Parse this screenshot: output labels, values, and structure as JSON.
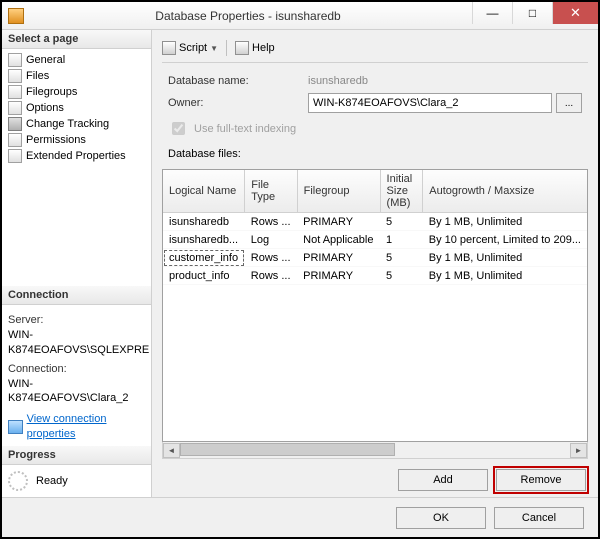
{
  "window": {
    "title": "Database Properties - isunsharedb"
  },
  "win_btns": {
    "min": "—",
    "max": "□",
    "close": "✕"
  },
  "left": {
    "select_page": "Select a page",
    "pages": [
      "General",
      "Files",
      "Filegroups",
      "Options",
      "Change Tracking",
      "Permissions",
      "Extended Properties"
    ],
    "connection_hdr": "Connection",
    "server_lbl": "Server:",
    "server_val": "WIN-K874EOAFOVS\\SQLEXPRE",
    "connection_lbl": "Connection:",
    "connection_val": "WIN-K874EOAFOVS\\Clara_2",
    "view_props": "View connection properties",
    "progress_hdr": "Progress",
    "progress_val": "Ready"
  },
  "toolbar": {
    "script": "Script",
    "help": "Help"
  },
  "form": {
    "db_name_lbl": "Database name:",
    "db_name_val": "isunsharedb",
    "owner_lbl": "Owner:",
    "owner_val": "WIN-K874EOAFOVS\\Clara_2",
    "browse": "...",
    "fulltext": "Use full-text indexing",
    "files_lbl": "Database files:"
  },
  "grid": {
    "cols": [
      "Logical Name",
      "File Type",
      "Filegroup",
      "Initial Size (MB)",
      "Autogrowth / Maxsize"
    ],
    "rows": [
      {
        "name": "isunsharedb",
        "type": "Rows ...",
        "fg": "PRIMARY",
        "size": "5",
        "ag": "By 1 MB, Unlimited"
      },
      {
        "name": "isunsharedb...",
        "type": "Log",
        "fg": "Not Applicable",
        "size": "1",
        "ag": "By 10 percent, Limited to 209..."
      },
      {
        "name": "customer_info",
        "type": "Rows ...",
        "fg": "PRIMARY",
        "size": "5",
        "ag": "By 1 MB, Unlimited"
      },
      {
        "name": "product_info",
        "type": "Rows ...",
        "fg": "PRIMARY",
        "size": "5",
        "ag": "By 1 MB, Unlimited"
      }
    ],
    "selected_row": 2
  },
  "buttons": {
    "add": "Add",
    "remove": "Remove",
    "ok": "OK",
    "cancel": "Cancel"
  }
}
